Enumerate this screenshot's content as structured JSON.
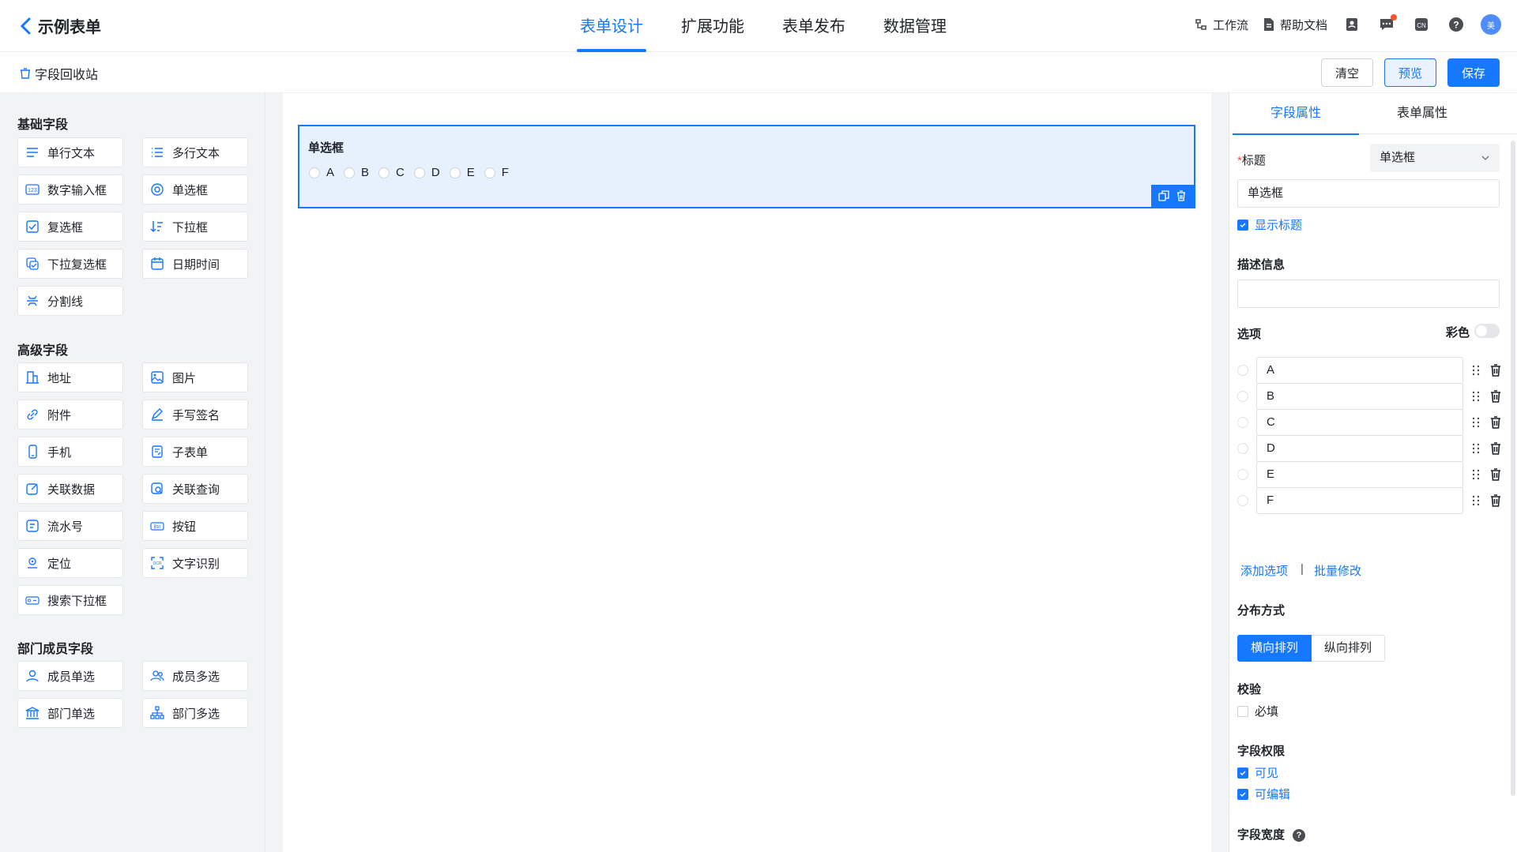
{
  "header": {
    "back_title": "示例表单",
    "tabs": [
      "表单设计",
      "扩展功能",
      "表单发布",
      "数据管理"
    ],
    "workflow": "工作流",
    "help_docs": "帮助文档",
    "avatar_text": "美",
    "accent": "#1677ff"
  },
  "subbar": {
    "recycle": "字段回收站",
    "clear": "清空",
    "preview": "预览",
    "save": "保存"
  },
  "left": {
    "basic_title": "基础字段",
    "basic": [
      "单行文本",
      "多行文本",
      "数字输入框",
      "单选框",
      "复选框",
      "下拉框",
      "下拉复选框",
      "日期时间",
      "分割线"
    ],
    "advanced_title": "高级字段",
    "advanced": [
      "地址",
      "图片",
      "附件",
      "手写签名",
      "手机",
      "子表单",
      "关联数据",
      "关联查询",
      "流水号",
      "按钮",
      "定位",
      "文字识别",
      "搜索下拉框"
    ],
    "member_title": "部门成员字段",
    "member": [
      "成员单选",
      "成员多选",
      "部门单选",
      "部门多选"
    ]
  },
  "canvas": {
    "field_label": "单选框",
    "options": [
      "A",
      "B",
      "C",
      "D",
      "E",
      "F"
    ]
  },
  "right": {
    "tabs": [
      "字段属性",
      "表单属性"
    ],
    "title_label": "标题",
    "title_required_mark": "*",
    "field_type": "单选框",
    "title_value": "单选框",
    "show_title": "显示标题",
    "desc_label": "描述信息",
    "desc_value": "",
    "options_label": "选项",
    "color_label": "彩色",
    "option_values": [
      "A",
      "B",
      "C",
      "D",
      "E",
      "F"
    ],
    "add_option": "添加选项",
    "separator": "|",
    "batch_edit": "批量修改",
    "layout_label": "分布方式",
    "layout_horizontal": "横向排列",
    "layout_vertical": "纵向排列",
    "validate_label": "校验",
    "required": "必填",
    "perm_label": "字段权限",
    "visible": "可见",
    "editable": "可编辑",
    "width_label": "字段宽度",
    "width_help": "?"
  }
}
